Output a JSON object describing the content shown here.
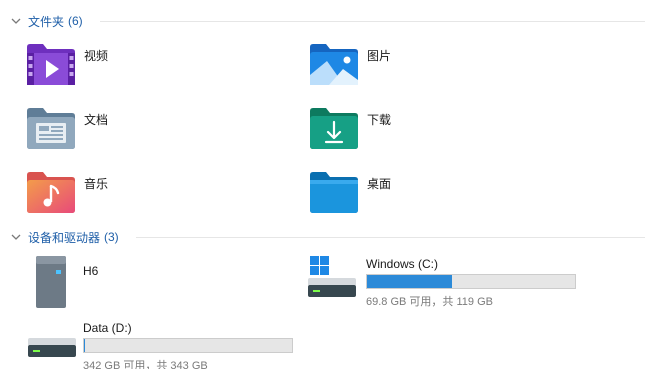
{
  "folders_group": {
    "title": "文件夹",
    "count": "(6)",
    "items": [
      {
        "label": "视频",
        "icon": "videos-folder-icon"
      },
      {
        "label": "图片",
        "icon": "pictures-folder-icon"
      },
      {
        "label": "文档",
        "icon": "documents-folder-icon"
      },
      {
        "label": "下载",
        "icon": "downloads-folder-icon"
      },
      {
        "label": "音乐",
        "icon": "music-folder-icon"
      },
      {
        "label": "桌面",
        "icon": "desktop-folder-icon"
      }
    ]
  },
  "drives_group": {
    "title": "设备和驱动器",
    "count": "(3)",
    "items": [
      {
        "name": "H6",
        "icon": "removable-drive-icon"
      },
      {
        "name": "Windows (C:)",
        "icon": "system-drive-icon",
        "used_fraction": 0.41,
        "info": "69.8 GB 可用，共 119 GB"
      },
      {
        "name": "Data (D:)",
        "icon": "hard-drive-icon",
        "used_fraction": 0.003,
        "info": "342 GB 可用，共 343 GB"
      }
    ]
  },
  "colors": {
    "accent": "#1f5fa8",
    "bar_fill": "#2c8ad8",
    "bar_track": "#e6e6e6"
  }
}
